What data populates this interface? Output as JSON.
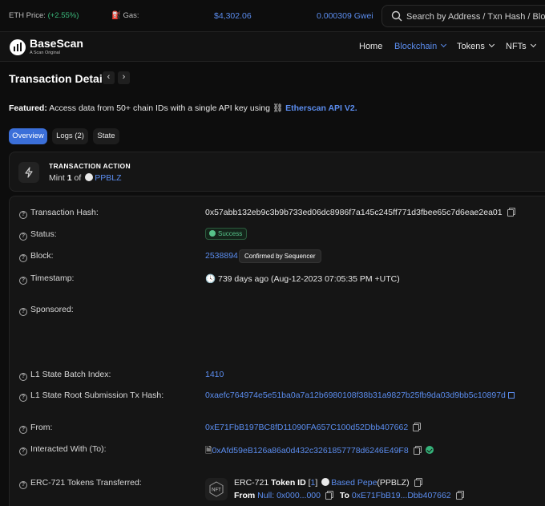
{
  "topbar": {
    "eth_label": "ETH Price:",
    "eth_price": "$4,302.06",
    "eth_change": "(+2.55%)",
    "gas_label": "Gas:",
    "gas_value": "0.000309 Gwei",
    "search_placeholder": "Search by Address / Txn Hash / Block"
  },
  "brand": {
    "name": "BaseScan",
    "tagline": "A Scan Original"
  },
  "nav": {
    "home": "Home",
    "blockchain": "Blockchain",
    "tokens": "Tokens",
    "nfts": "NFTs"
  },
  "page": {
    "title": "Transaction Details",
    "prev": "‹",
    "next": "›"
  },
  "featured": {
    "label": "Featured:",
    "text": "Access data from 50+ chain IDs with a single API key using",
    "link": "Etherscan API V2."
  },
  "tabs": [
    "Overview",
    "Logs (2)",
    "State"
  ],
  "action": {
    "label": "TRANSACTION ACTION",
    "verb": "Mint",
    "count": "1",
    "of": "of",
    "token": "PPBLZ"
  },
  "rows": {
    "tx_hash": {
      "label": "Transaction Hash:",
      "value": "0x57abb132eb9c3b9b733ed06dc8986f7a145c245ff771d3fbee65c7d6eae2ea01"
    },
    "status": {
      "label": "Status:",
      "value": "Success"
    },
    "block": {
      "label": "Block:",
      "value": "2538894",
      "tooltip": "Confirmed by Sequencer"
    },
    "timestamp": {
      "label": "Timestamp:",
      "value": "739 days ago (Aug-12-2023 07:05:35 PM +UTC)"
    },
    "sponsored": {
      "label": "Sponsored:"
    },
    "l1_batch": {
      "label": "L1 State Batch Index:",
      "value": "1410"
    },
    "l1_root": {
      "label": "L1 State Root Submission Tx Hash:",
      "value": "0xaefc764974e5e51ba0a7a12b6980108f38b31a9827b25fb9da03d9bb5c10897d"
    },
    "from": {
      "label": "From:",
      "value": "0xE71FbB197BC8fD11090FA657C100d52Dbb407662"
    },
    "to": {
      "label": "Interacted With (To):",
      "value": "0xAfd59eB126a86a0d432c3261857778d6246E49F8"
    },
    "erc721": {
      "label": "ERC-721 Tokens Transferred:",
      "standard": "ERC-721",
      "token_id_label": "Token ID",
      "token_id": "1",
      "token_name": "Based Pepe",
      "token_symbol": "(PPBLZ)",
      "from_label": "From",
      "from_value": "Null: 0x000...000",
      "to_label": "To",
      "to_value": "0xE71FbB19...Dbb407662",
      "nft_icon_text": "NFT"
    }
  },
  "colors": {
    "accent": "#5b8def",
    "success": "#57c38a",
    "tab_active": "#3b6fd9"
  }
}
